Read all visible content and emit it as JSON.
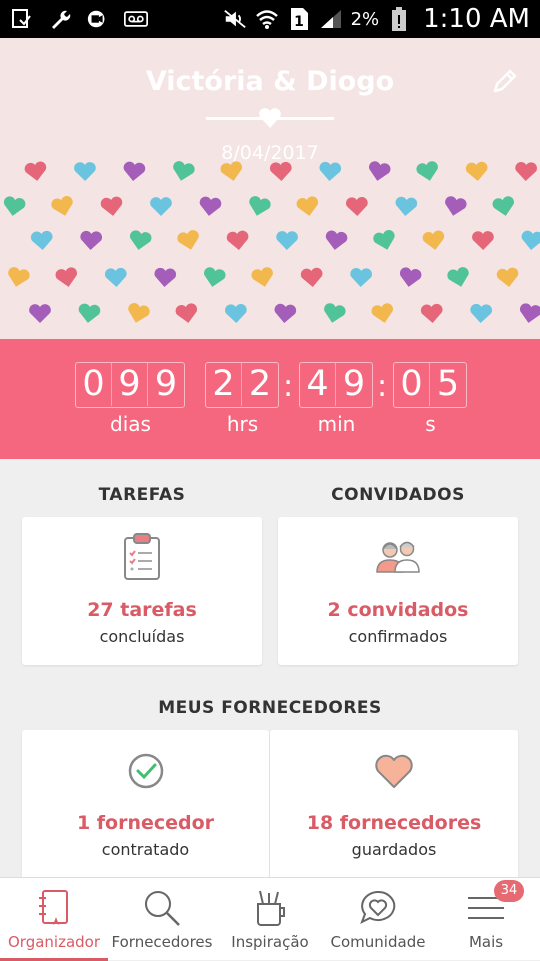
{
  "status_bar": {
    "battery_percent": "2%",
    "time": "1:10 AM",
    "icons": [
      "notification-icon",
      "wrench-icon",
      "video-icon",
      "voicemail-icon",
      "mute-icon",
      "wifi-icon",
      "sim-icon",
      "signal-icon",
      "battery-icon"
    ]
  },
  "header": {
    "couple_name": "Victória & Diogo",
    "wedding_date": "8/04/2017",
    "edit_icon": "pencil-icon",
    "heart_colors": [
      "#e2586c",
      "#9b4fb5",
      "#f2b33d",
      "#5bc0de",
      "#3fbf8f"
    ]
  },
  "countdown": {
    "days_digits": [
      "0",
      "9",
      "9"
    ],
    "hours_digits": [
      "2",
      "2"
    ],
    "minutes_digits": [
      "4",
      "9"
    ],
    "seconds_digits": [
      "0",
      "5"
    ],
    "separator": ":",
    "days_label": "dias",
    "hours_label": "hrs",
    "minutes_label": "min",
    "seconds_label": "s",
    "background": "#f5677e"
  },
  "tasks": {
    "title": "TAREFAS",
    "value": "27 tarefas",
    "subtitle": "concluídas",
    "icon": "clipboard-icon"
  },
  "guests": {
    "title": "CONVIDADOS",
    "value": "2 convidados",
    "subtitle": "confirmados",
    "icon": "guests-icon"
  },
  "vendors": {
    "title": "MEUS FORNECEDORES",
    "hired": {
      "value": "1 fornecedor",
      "subtitle": "contratado",
      "icon": "check-circle-icon"
    },
    "saved": {
      "value": "18 fornecedores",
      "subtitle": "guardados",
      "icon": "heart-icon"
    }
  },
  "bottom_nav": {
    "items": [
      {
        "label": "Organizador",
        "icon": "planner-icon",
        "active": true
      },
      {
        "label": "Fornecedores",
        "icon": "search-icon",
        "active": false
      },
      {
        "label": "Inspiração",
        "icon": "inspiration-icon",
        "active": false
      },
      {
        "label": "Comunidade",
        "icon": "chat-heart-icon",
        "active": false
      },
      {
        "label": "Mais",
        "icon": "menu-icon",
        "active": false,
        "badge": "34"
      }
    ]
  },
  "accent_color": "#d95b66"
}
